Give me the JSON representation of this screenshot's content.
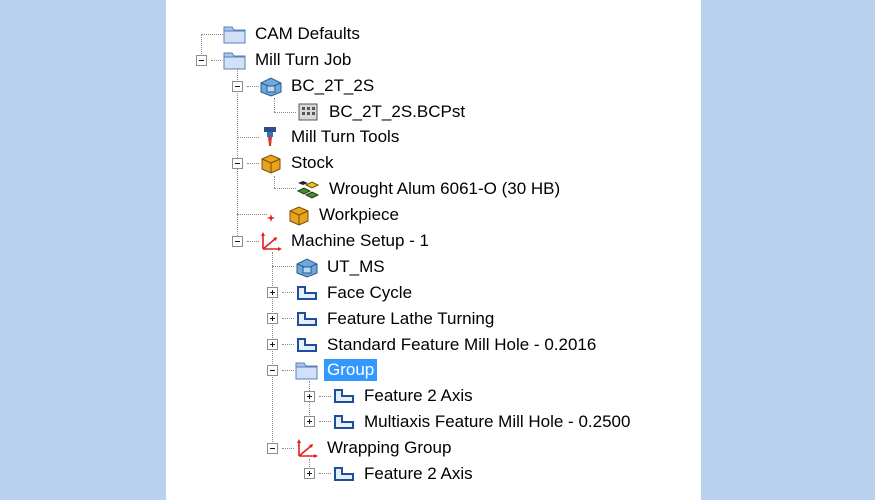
{
  "tree": {
    "items": [
      {
        "label": "CAM Defaults",
        "icon": "folder-icon"
      },
      {
        "label": "Mill Turn Job",
        "icon": "folder-icon"
      },
      {
        "label": "BC_2T_2S",
        "icon": "machine-icon"
      },
      {
        "label": "BC_2T_2S.BCPst",
        "icon": "post-processor-icon"
      },
      {
        "label": "Mill Turn Tools",
        "icon": "tool-icon"
      },
      {
        "label": "Stock",
        "icon": "box-icon"
      },
      {
        "label": "Wrought Alum 6061-O (30 HB)",
        "icon": "material-icon"
      },
      {
        "label": "Workpiece",
        "icon": "box-icon"
      },
      {
        "label": "Machine Setup - 1",
        "icon": "coordinate-axes-icon"
      },
      {
        "label": "UT_MS",
        "icon": "machine-icon"
      },
      {
        "label": "Face Cycle",
        "icon": "feature-icon"
      },
      {
        "label": "Feature Lathe Turning",
        "icon": "feature-icon"
      },
      {
        "label": "Standard Feature Mill Hole - 0.2016",
        "icon": "feature-icon"
      },
      {
        "label": "Group",
        "icon": "folder-icon",
        "selected": true
      },
      {
        "label": "Feature 2 Axis",
        "icon": "feature-icon"
      },
      {
        "label": "Multiaxis Feature Mill Hole - 0.2500",
        "icon": "feature-icon"
      },
      {
        "label": "Wrapping Group",
        "icon": "coordinate-axes-icon"
      },
      {
        "label": "Feature 2 Axis",
        "icon": "feature-icon"
      }
    ]
  },
  "colors": {
    "background": "#b8d1ee",
    "panel": "#ffffff",
    "selection": "#3399ff",
    "feature_icon": "#1f4e9c",
    "axes_icon": "#e0201c",
    "box_icon": "#e8a321"
  }
}
